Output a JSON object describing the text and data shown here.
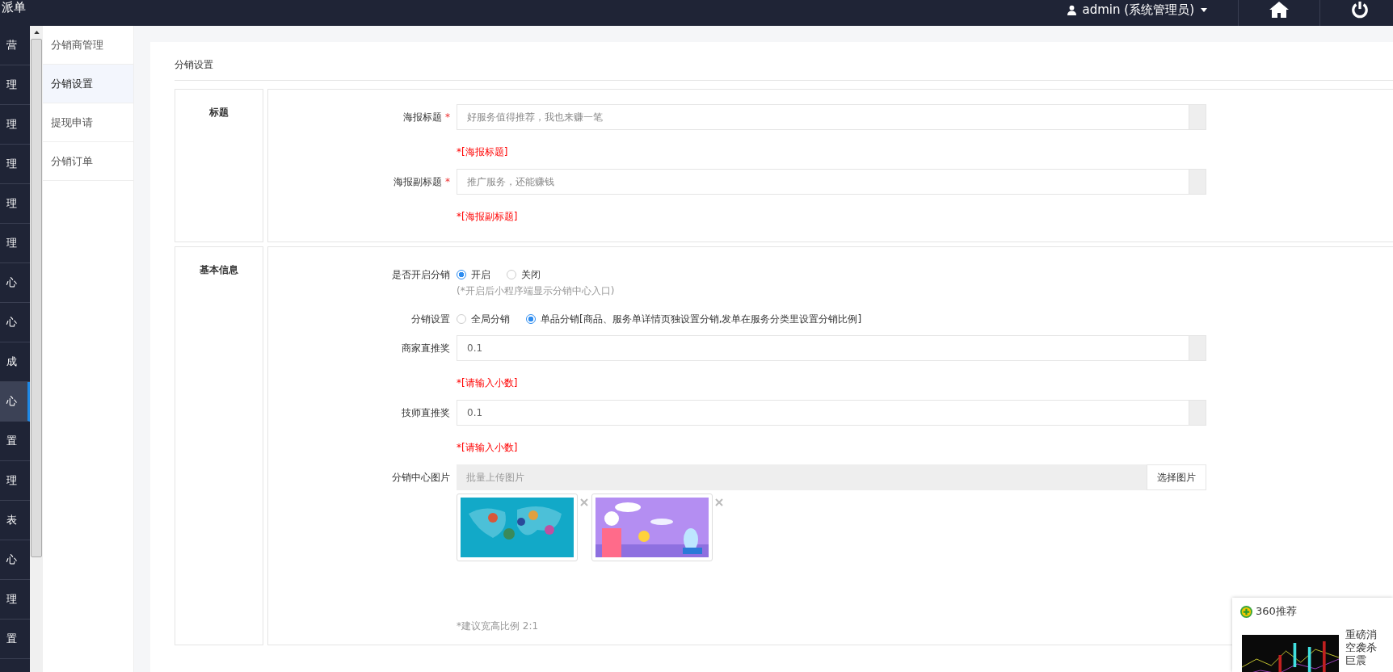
{
  "topbar": {
    "brand": "派单",
    "user": "admin (系统管理员)"
  },
  "sidebar": {
    "items": [
      {
        "label": "营",
        "selected": false
      },
      {
        "label": "理",
        "selected": false
      },
      {
        "label": "理",
        "selected": false
      },
      {
        "label": "理",
        "selected": false
      },
      {
        "label": "理",
        "selected": false
      },
      {
        "label": "理",
        "selected": false
      },
      {
        "label": "心",
        "selected": false
      },
      {
        "label": "心",
        "selected": false
      },
      {
        "label": "成",
        "selected": false
      },
      {
        "label": "心",
        "selected": true
      },
      {
        "label": "置",
        "selected": false
      },
      {
        "label": "理",
        "selected": false
      },
      {
        "label": "表",
        "selected": false
      },
      {
        "label": "心",
        "selected": false
      },
      {
        "label": "理",
        "selected": false
      },
      {
        "label": "置",
        "selected": false
      }
    ]
  },
  "submenu": {
    "items": [
      {
        "label": "分销商管理",
        "selected": false
      },
      {
        "label": "分销设置",
        "selected": true
      },
      {
        "label": "提现申请",
        "selected": false
      },
      {
        "label": "分销订单",
        "selected": false
      }
    ]
  },
  "page": {
    "title": "分销设置",
    "sections": [
      {
        "title": "标题",
        "rows": [
          {
            "kind": "input",
            "label": "海报标题",
            "required_mark": "*",
            "placeholder": "好服务值得推荐，我也来赚一笔",
            "error": "*[海报标题]"
          },
          {
            "kind": "input",
            "label": "海报副标题",
            "required_mark": "*",
            "placeholder": "推广服务，还能赚钱",
            "error": "*[海报副标题]"
          }
        ]
      },
      {
        "title": "基本信息",
        "rows": [
          {
            "kind": "radio",
            "label": "是否开启分销",
            "options": [
              {
                "label": "开启",
                "selected": true
              },
              {
                "label": "关闭",
                "selected": false
              }
            ],
            "hint": "(*开启后小程序端显示分销中心入口)"
          },
          {
            "kind": "radio",
            "label": "分销设置",
            "options": [
              {
                "label": "全局分销",
                "selected": false
              },
              {
                "label": "单品分销[商品、服务单详情页独设置分销,发单在服务分类里设置分销比例]",
                "selected": true
              }
            ]
          },
          {
            "kind": "input",
            "label": "商家直推奖",
            "value": "0.1",
            "error": "*[请输入小数]"
          },
          {
            "kind": "input",
            "label": "技师直推奖",
            "value": "0.1",
            "error": "*[请输入小数]"
          },
          {
            "kind": "upload",
            "label": "分销中心图片",
            "placeholder": "批量上传图片",
            "button": "选择图片",
            "hint": "*建议宽高比例 2:1"
          }
        ]
      }
    ]
  },
  "popup": {
    "title": "360推荐",
    "headline_lines": [
      "重磅消",
      "空袭杀",
      "巨震"
    ]
  }
}
